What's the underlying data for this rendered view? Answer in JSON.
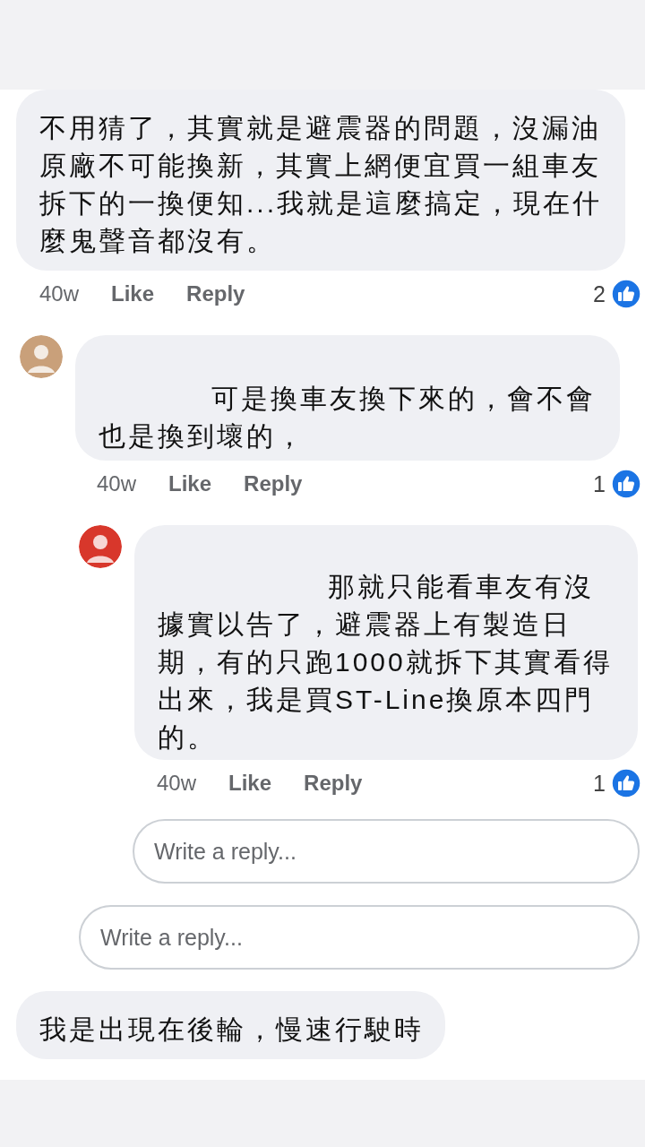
{
  "comments": [
    {
      "text": "不用猜了，其實就是避震器的問題，沒漏油原廠不可能換新，其實上網便宜買一組車友拆下的一換便知...我就是這麼搞定，現在什麼鬼聲音都沒有。",
      "time": "40w",
      "actions": [
        "Like",
        "Reply"
      ],
      "reactions": "2",
      "children": [
        {
          "text": "可是換車友換下來的，會不會也是換到壞的，",
          "time": "40w",
          "actions": [
            "Like",
            "Reply"
          ],
          "reactions": "1",
          "children": [
            {
              "text": "那就只能看車友有沒據實以告了，避震器上有製造日期，有的只跑1000就拆下其實看得出來，我是買ST-Line換原本四門的。",
              "time": "40w",
              "actions": [
                "Like",
                "Reply"
              ],
              "reactions": "1"
            }
          ],
          "reply_field": {
            "placeholder": "Write a reply..."
          }
        }
      ],
      "reply_field": {
        "placeholder": "Write a reply..."
      }
    },
    {
      "text": "我是出現在後輪，慢速行駛時"
    }
  ]
}
